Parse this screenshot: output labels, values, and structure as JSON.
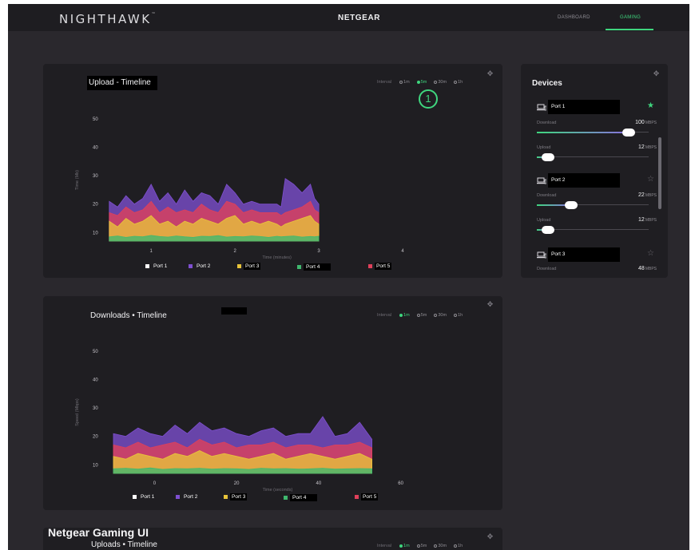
{
  "nav": {
    "brand": "NIGHTHAWK",
    "brand_mark": "™",
    "vendor": "NETGEAR",
    "tabs": [
      {
        "label": "DASHBOARD"
      },
      {
        "label": "GAMING",
        "active": true
      }
    ]
  },
  "colors": {
    "accent": "#3fd67e",
    "port1": "#ffffff",
    "port2": "#7e4fd0",
    "port3": "#e8c43a",
    "port4": "#3fb86e",
    "port5": "#e0405a"
  },
  "icons": {
    "move": "move-icon",
    "device": "laptop-icon",
    "favorite": "star-icon"
  },
  "upload_panel": {
    "title": "Upload - Timeline",
    "interval_label": "Interval",
    "intervals": [
      {
        "label": "1m"
      },
      {
        "label": "5m",
        "active": true
      },
      {
        "label": "30m"
      },
      {
        "label": "1h"
      }
    ],
    "callout": "1",
    "y_label": "Time (Mb)",
    "x_label": "Time (minutes)",
    "legend": [
      "Port 1",
      "Port 2",
      "Port 3",
      "Port 4",
      "Port 5"
    ]
  },
  "download_panel": {
    "title": "Downloads • Timeline",
    "interval_label": "Interval",
    "intervals": [
      {
        "label": "1m",
        "active": true
      },
      {
        "label": "5m"
      },
      {
        "label": "30m"
      },
      {
        "label": "1h"
      }
    ],
    "y_label": "Speed (Mbps)",
    "x_label": "Time (seconds)",
    "legend": [
      "Port 1",
      "Port 2",
      "Port 3",
      "Port 4",
      "Port 5"
    ]
  },
  "upload2_panel": {
    "heading": "Netgear Gaming UI",
    "title": "Uploads • Timeline",
    "interval_label": "Interval",
    "intervals": [
      {
        "label": "1m",
        "active": true
      },
      {
        "label": "5m"
      },
      {
        "label": "30m"
      },
      {
        "label": "1h"
      }
    ]
  },
  "devices": {
    "title": "Devices",
    "items": [
      {
        "name": "Port 1",
        "favorite": true,
        "download_label": "Download",
        "download_value": "100",
        "download_unit": "MBPS",
        "download_level": 0.82,
        "upload_label": "Upload",
        "upload_value": "12",
        "upload_unit": "MBPS",
        "upload_level": 0.1
      },
      {
        "name": "Port 2",
        "favorite": false,
        "download_label": "Download",
        "download_value": "22",
        "download_unit": "MBPS",
        "download_level": 0.31,
        "upload_label": "Upload",
        "upload_value": "12",
        "upload_unit": "MBPS",
        "upload_level": 0.1
      },
      {
        "name": "Port 3",
        "favorite": false,
        "download_label": "Download",
        "download_value": "48",
        "download_unit": "MBPS"
      }
    ]
  },
  "chart_data": [
    {
      "type": "area",
      "title": "Upload - Timeline",
      "xlabel": "Time (minutes)",
      "ylabel": "Time (Mb)",
      "xlim": [
        0.55,
        4.0
      ],
      "ylim": [
        7,
        50
      ],
      "xticks": [
        1,
        2,
        3,
        4
      ],
      "yticks": [
        10,
        20,
        30,
        40,
        50
      ],
      "x": [
        0.5,
        0.6,
        0.7,
        0.8,
        0.9,
        1.0,
        1.1,
        1.2,
        1.3,
        1.4,
        1.5,
        1.6,
        1.7,
        1.8,
        1.9,
        2.0,
        2.1,
        2.2,
        2.3,
        2.4,
        2.5,
        2.55,
        2.6,
        2.7,
        2.8,
        2.9,
        2.95,
        3.0
      ],
      "series": [
        {
          "name": "Port 4",
          "values": [
            8.5,
            8.8,
            8.3,
            8.7,
            8.5,
            9.0,
            8.6,
            8.4,
            8.8,
            8.5,
            8.3,
            8.7,
            8.6,
            8.9,
            8.4,
            8.6,
            8.5,
            8.8,
            8.6,
            8.3,
            8.7,
            8.5,
            8.6,
            8.8,
            8.4,
            8.6,
            8.5,
            8.7
          ]
        },
        {
          "name": "Port 3",
          "values": [
            14,
            12,
            15,
            13,
            14,
            16,
            13,
            14,
            12,
            14,
            13,
            15,
            14,
            13,
            15,
            16,
            13,
            14,
            13,
            14,
            13,
            12,
            13,
            14,
            15,
            16,
            14,
            13
          ]
        },
        {
          "name": "Port 5",
          "values": [
            17,
            16,
            19,
            17,
            18,
            21,
            17,
            19,
            17,
            18,
            17,
            20,
            18,
            17,
            21,
            20,
            17,
            18,
            17,
            17,
            17,
            16,
            17,
            18,
            19,
            21,
            18,
            17
          ]
        },
        {
          "name": "Port 2",
          "values": [
            21,
            19,
            23,
            20,
            22,
            27,
            21,
            24,
            20,
            25,
            21,
            24,
            23,
            20,
            27,
            24,
            20,
            21,
            20,
            20,
            20,
            19,
            29,
            27,
            24,
            27,
            22,
            20
          ]
        }
      ]
    },
    {
      "type": "area",
      "title": "Downloads • Timeline",
      "xlabel": "Time (seconds)",
      "ylabel": "Speed (Mbps)",
      "xlim": [
        -10,
        63
      ],
      "ylim": [
        7,
        50
      ],
      "xticks": [
        0,
        20,
        40,
        60
      ],
      "yticks": [
        10,
        20,
        30,
        40,
        50
      ],
      "x": [
        -10,
        -7,
        -4,
        -1,
        2,
        5,
        8,
        11,
        14,
        17,
        20,
        23,
        26,
        29,
        32,
        35,
        38,
        41,
        44,
        47,
        50,
        53
      ],
      "series": [
        {
          "name": "Port 4",
          "values": [
            8.6,
            8.8,
            8.5,
            8.9,
            8.4,
            8.7,
            8.6,
            8.8,
            8.5,
            8.7,
            8.6,
            8.4,
            8.8,
            8.6,
            8.7,
            8.5,
            8.6,
            8.8,
            8.5,
            8.6,
            8.7,
            8.6
          ]
        },
        {
          "name": "Port 3",
          "values": [
            13,
            12,
            14,
            13,
            12,
            14,
            13,
            15,
            13,
            14,
            13,
            12,
            13,
            14,
            12,
            13,
            14,
            13,
            12,
            13,
            14,
            12
          ]
        },
        {
          "name": "Port 5",
          "values": [
            17,
            16,
            18,
            16,
            17,
            18,
            16,
            19,
            17,
            18,
            16,
            17,
            17,
            18,
            16,
            17,
            17,
            16,
            17,
            17,
            18,
            16
          ]
        },
        {
          "name": "Port 2",
          "values": [
            21,
            20,
            23,
            21,
            20,
            24,
            21,
            25,
            22,
            23,
            21,
            20,
            22,
            23,
            20,
            21,
            21,
            27,
            20,
            21,
            25,
            19
          ]
        }
      ]
    }
  ]
}
